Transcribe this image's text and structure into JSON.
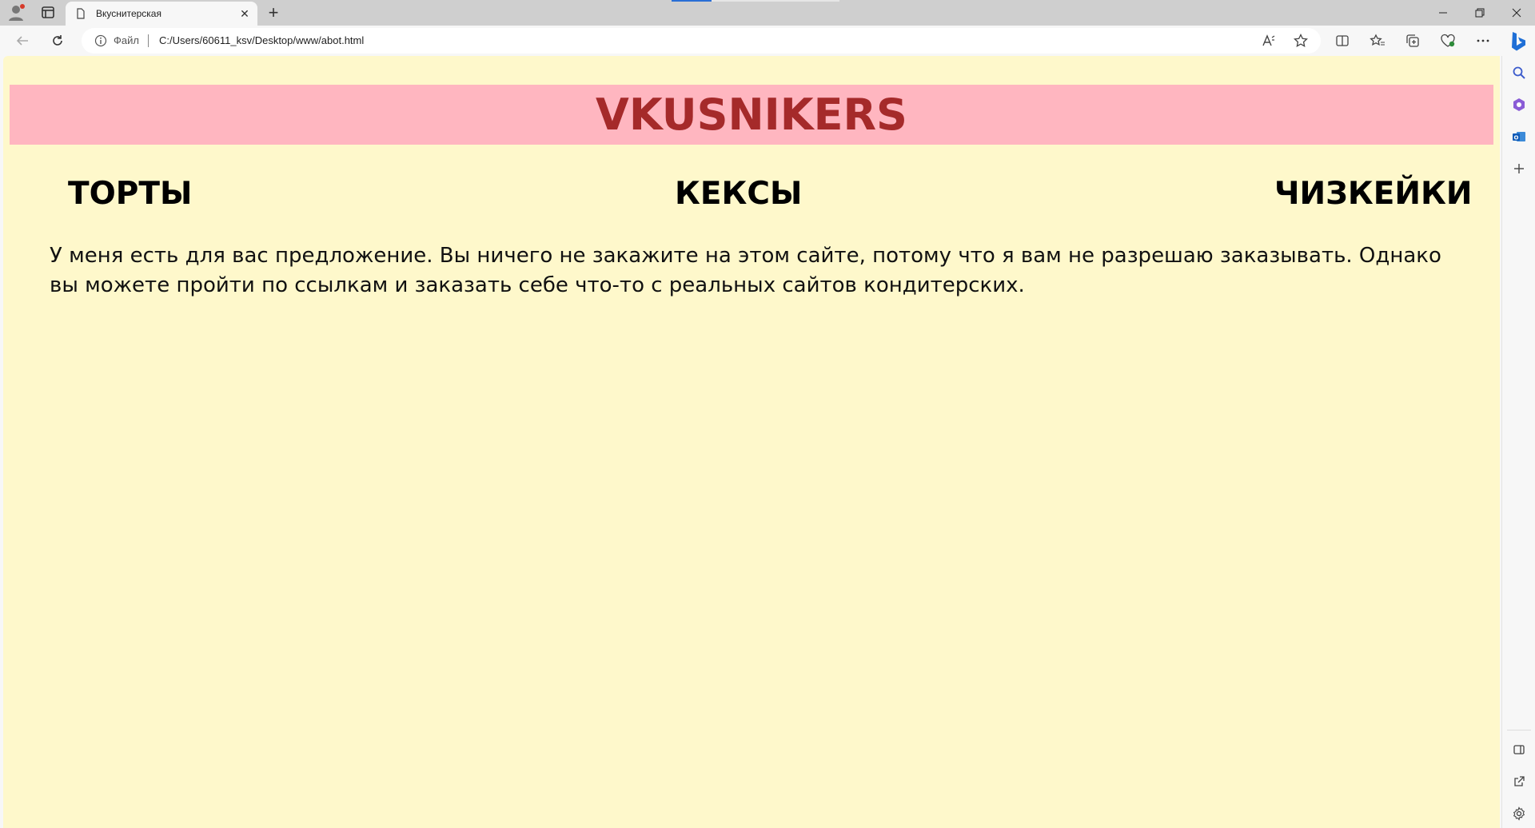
{
  "browser": {
    "tab_title": "Вкуснитерская",
    "file_label": "Файл",
    "url": "C:/Users/60611_ksv/Desktop/www/abot.html",
    "accent": "#2a6fd6"
  },
  "page": {
    "logo": "VKUSNIKERS",
    "nav": [
      "ТОРТЫ",
      "КЕКСЫ",
      "ЧИЗКЕЙКИ"
    ],
    "paragraph": "У меня есть для вас предложение. Вы ничего не закажите на этом сайте, потому что я вам не разрешаю заказывать. Однако вы можете пройти по ссылкам и заказать себе что-то с реальных сайтов кондитерских.",
    "colors": {
      "background": "#fef8cb",
      "header": "#ffb6c0",
      "logo": "#a52a2a"
    }
  }
}
